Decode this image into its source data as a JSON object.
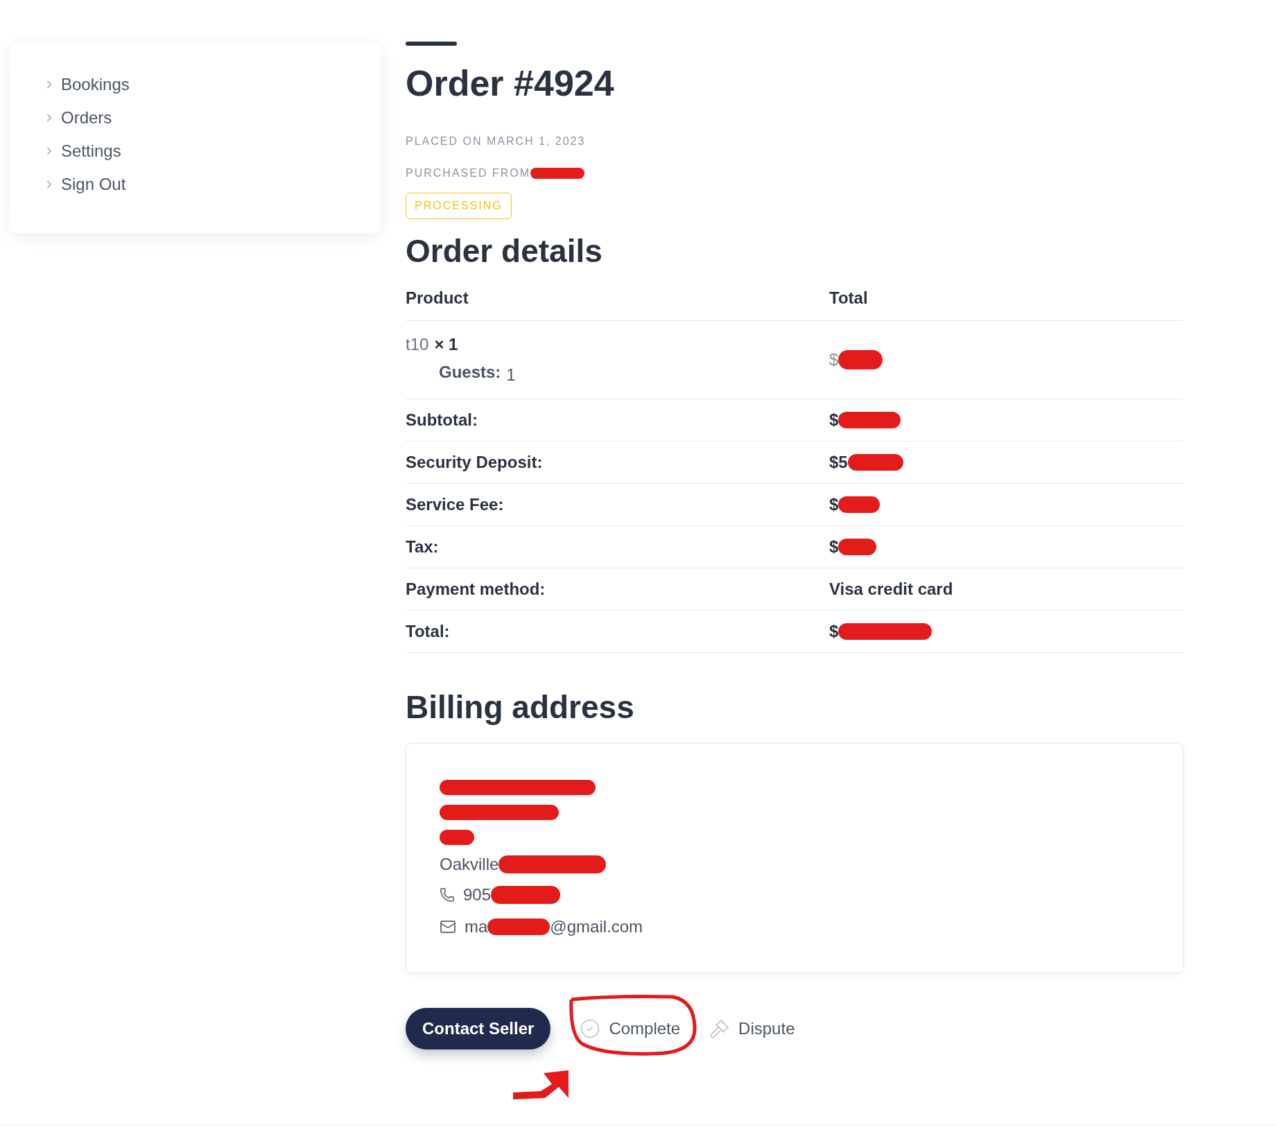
{
  "sidebar": {
    "items": [
      {
        "label": "Bookings"
      },
      {
        "label": "Orders"
      },
      {
        "label": "Settings"
      },
      {
        "label": "Sign Out"
      }
    ]
  },
  "order": {
    "title": "Order #4924",
    "placed": "PLACED ON MARCH 1, 2023",
    "purchased_from": {
      "label": "PURCHASED FROM",
      "redacted": true
    },
    "status": "PROCESSING"
  },
  "details": {
    "heading": "Order details",
    "columns": [
      "Product",
      "Total"
    ],
    "item": {
      "name": "t10",
      "qty": "× 1",
      "meta_label": "Guests:",
      "meta_value": "1",
      "total": {
        "text": "$",
        "redacted": true
      }
    },
    "rows": [
      {
        "label": "Subtotal:",
        "value": {
          "text": "$",
          "redacted": true
        }
      },
      {
        "label": "Security Deposit:",
        "value": {
          "text": "$5",
          "redacted": true
        }
      },
      {
        "label": "Service Fee:",
        "value": {
          "text": "$",
          "redacted": true
        }
      },
      {
        "label": "Tax:",
        "value": {
          "text": "$",
          "redacted": true
        }
      },
      {
        "label": "Payment method:",
        "value": {
          "text": "Visa credit card",
          "redacted": false
        }
      },
      {
        "label": "Total:",
        "value": {
          "text": "$",
          "redacted": true
        }
      }
    ]
  },
  "billing": {
    "heading": "Billing address",
    "lines": [
      {
        "kind": "hidden"
      },
      {
        "kind": "hidden"
      },
      {
        "kind": "hidden"
      },
      {
        "kind": "city",
        "text": "Oakville"
      },
      {
        "kind": "phone",
        "text": "905"
      },
      {
        "kind": "email",
        "text": "ma",
        "tail": "@gmail.com"
      }
    ]
  },
  "actions": [
    {
      "kind": "primary",
      "label": "Contact Seller"
    },
    {
      "kind": "complete",
      "label": "Complete",
      "circled": true
    },
    {
      "kind": "dispute",
      "label": "Dispute"
    }
  ]
}
